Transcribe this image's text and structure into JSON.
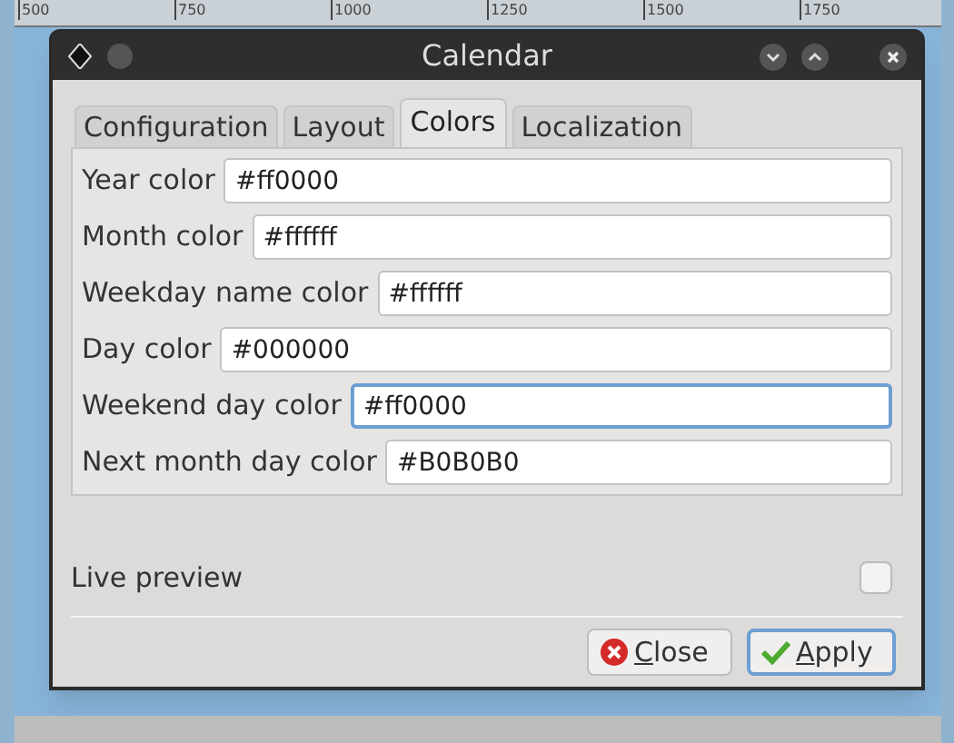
{
  "ruler": {
    "labels": [
      "500",
      "750",
      "1000",
      "1250",
      "1500",
      "1750"
    ]
  },
  "window": {
    "title": "Calendar"
  },
  "tabs": [
    {
      "label": "Configuration",
      "selected": false
    },
    {
      "label": "Layout",
      "selected": false
    },
    {
      "label": "Colors",
      "selected": true
    },
    {
      "label": "Localization",
      "selected": false
    }
  ],
  "fields": [
    {
      "label": "Year color",
      "value": "#ff0000",
      "focused": false
    },
    {
      "label": "Month color",
      "value": "#ffffff",
      "focused": false
    },
    {
      "label": "Weekday name color",
      "value": "#ffffff",
      "focused": false
    },
    {
      "label": "Day color",
      "value": "#000000",
      "focused": false
    },
    {
      "label": "Weekend day color",
      "value": "#ff0000",
      "focused": true
    },
    {
      "label": "Next month day color",
      "value": "#B0B0B0",
      "focused": false
    }
  ],
  "live_preview": {
    "label": "Live preview",
    "checked": false
  },
  "buttons": [
    {
      "kind": "close",
      "label": "Close",
      "default": false
    },
    {
      "kind": "apply",
      "label": "Apply",
      "default": true
    }
  ]
}
